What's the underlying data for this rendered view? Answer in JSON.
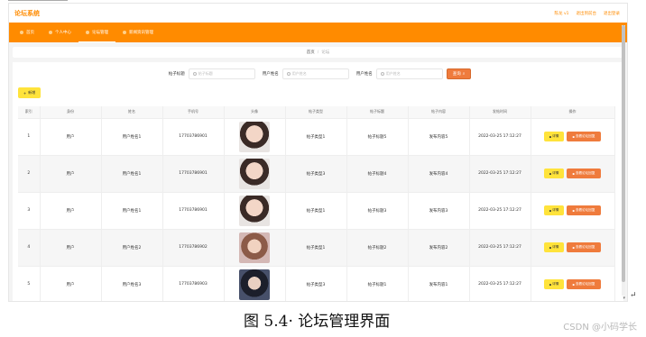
{
  "app": {
    "brand": "论坛系统",
    "top_links": [
      "陈龙 v1",
      "退出到前台",
      "退出登录"
    ]
  },
  "nav": [
    {
      "label": "首页",
      "active": false
    },
    {
      "label": "个人中心",
      "active": false
    },
    {
      "label": "论坛管理",
      "active": true
    },
    {
      "label": "新闻资讯管理",
      "active": false
    }
  ],
  "breadcrumb": {
    "home": "首页",
    "sep": "/",
    "current": "论坛"
  },
  "search": {
    "fields": [
      {
        "label": "帖子标题",
        "placeholder": "帖子标题"
      },
      {
        "label": "用户姓名",
        "placeholder": "用户姓名"
      },
      {
        "label": "用户姓名",
        "placeholder": "用户姓名"
      }
    ],
    "button": "查询"
  },
  "add_button": "新增",
  "table": {
    "headers": [
      "索引",
      "身份",
      "姓名",
      "手机号",
      "头像",
      "帖子类型",
      "帖子标题",
      "帖子内容",
      "发帖时间",
      "操作"
    ],
    "rows": [
      {
        "index": "1",
        "role": "用户",
        "name": "用户姓名1",
        "phone": "17703786901",
        "avatar": "av1",
        "type": "帖子类型1",
        "title": "帖子标题5",
        "content": "发布内容5",
        "time": "2022-03-25 17:12:27"
      },
      {
        "index": "2",
        "role": "用户",
        "name": "用户姓名1",
        "phone": "17703786901",
        "avatar": "av1",
        "type": "帖子类型3",
        "title": "帖子标题4",
        "content": "发布内容4",
        "time": "2022-03-25 17:12:27"
      },
      {
        "index": "3",
        "role": "用户",
        "name": "用户姓名1",
        "phone": "17703786901",
        "avatar": "av1",
        "type": "帖子类型1",
        "title": "帖子标题3",
        "content": "发布内容3",
        "time": "2022-03-25 17:12:27"
      },
      {
        "index": "4",
        "role": "用户",
        "name": "用户姓名2",
        "phone": "17703786902",
        "avatar": "av2",
        "type": "帖子类型1",
        "title": "帖子标题2",
        "content": "发布内容2",
        "time": "2022-03-25 17:12:27"
      },
      {
        "index": "5",
        "role": "用户",
        "name": "用户姓名3",
        "phone": "17703786903",
        "avatar": "av3",
        "type": "帖子类型3",
        "title": "帖子标题1",
        "content": "发布内容1",
        "time": "2022-03-25 17:12:27"
      }
    ],
    "op_detail": "详情",
    "op_reply": "查看论坛回复"
  },
  "caption": "图 5.4· 论坛管理界面",
  "caption_mark": "↵",
  "watermark": "CSDN @小码学长",
  "colors": {
    "accent": "#ff8b00",
    "query_button": "#ef7b3c",
    "detail_button": "#ffe33b",
    "reply_button": "#ef7b3c"
  }
}
